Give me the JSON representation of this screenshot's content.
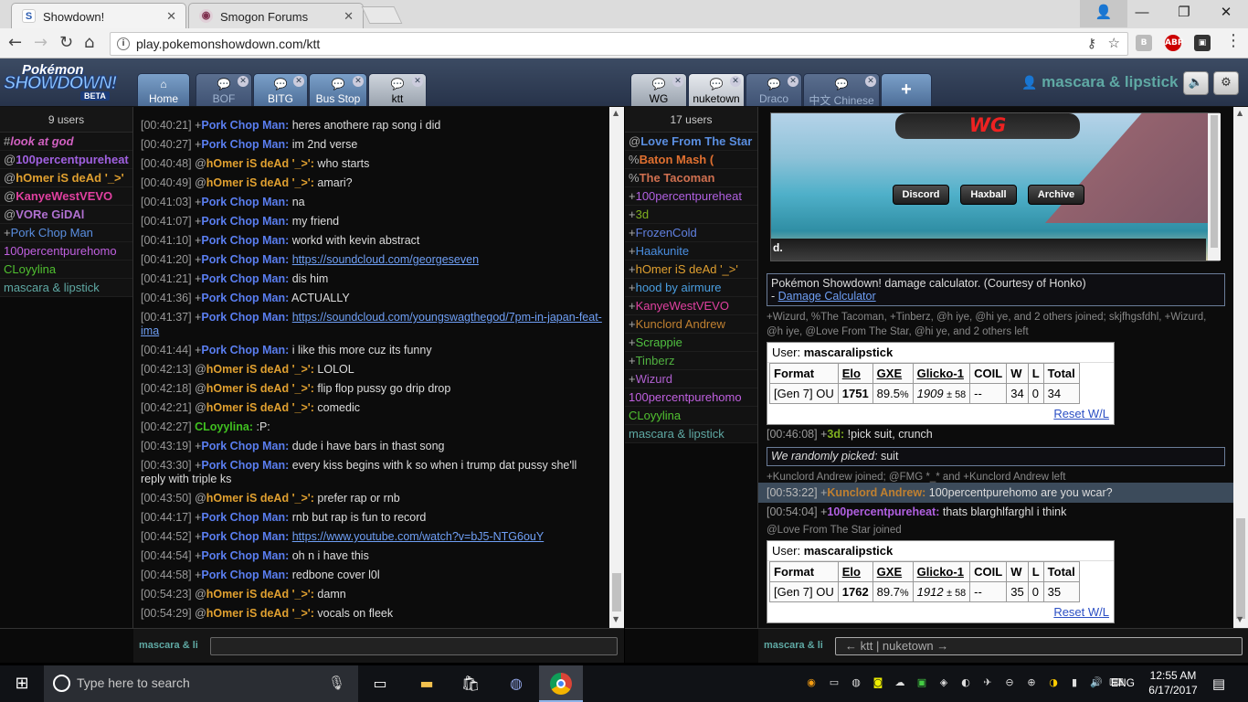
{
  "browser": {
    "tabs": [
      {
        "title": "Showdown!",
        "active": true
      },
      {
        "title": "Smogon Forums",
        "active": false
      }
    ],
    "url": "play.pokemonshowdown.com/ktt"
  },
  "ps": {
    "logo_top": "Pokémon",
    "logo_main": "SHOWDOWN!",
    "logo_badge": "BETA",
    "left_tabs": [
      "Home",
      "BOF",
      "BITG",
      "Bus Stop",
      "ktt"
    ],
    "right_tabs": [
      "WG",
      "nuketown",
      "Draco",
      "中文 Chinese"
    ],
    "add_tab": "+",
    "username": "mascara & lipstick"
  },
  "room1": {
    "user_count": "9 users",
    "users": [
      {
        "rank": "#",
        "name": "look at god",
        "color": "#d060c0"
      },
      {
        "rank": "@",
        "name": "100percentpureheat",
        "color": "#a060e0"
      },
      {
        "rank": "@",
        "name": "hOmer iS deAd '_>'",
        "color": "#e0a030"
      },
      {
        "rank": "@",
        "name": "KanyeWestVEVO",
        "color": "#e040a0"
      },
      {
        "rank": "@",
        "name": "VORe GiDAl",
        "color": "#b070d0"
      },
      {
        "rank": "+",
        "name": "Pork Chop Man",
        "color": "#5a8ee0"
      },
      {
        "rank": " ",
        "name": "100percentpurehomo",
        "color": "#c060e0"
      },
      {
        "rank": " ",
        "name": "CLoyylina",
        "color": "#50c030"
      },
      {
        "rank": " ",
        "name": "mascara & lipstick",
        "color": "#5fa9a4"
      }
    ],
    "messages": [
      {
        "t": "[00:40:21]",
        "rank": "+",
        "user": "Pork Chop Man:",
        "c": "#5a7ef0",
        "msg": "heres anothere rap song i did"
      },
      {
        "t": "[00:40:27]",
        "rank": "+",
        "user": "Pork Chop Man:",
        "c": "#5a7ef0",
        "msg": "im 2nd verse"
      },
      {
        "t": "[00:40:48]",
        "rank": "@",
        "user": "hOmer iS deAd '_>':",
        "c": "#e0a030",
        "msg": "who starts"
      },
      {
        "t": "[00:40:49]",
        "rank": "@",
        "user": "hOmer iS deAd '_>':",
        "c": "#e0a030",
        "msg": "amari?"
      },
      {
        "t": "[00:41:03]",
        "rank": "+",
        "user": "Pork Chop Man:",
        "c": "#5a7ef0",
        "msg": "na"
      },
      {
        "t": "[00:41:07]",
        "rank": "+",
        "user": "Pork Chop Man:",
        "c": "#5a7ef0",
        "msg": "my friend"
      },
      {
        "t": "[00:41:10]",
        "rank": "+",
        "user": "Pork Chop Man:",
        "c": "#5a7ef0",
        "msg": "workd with kevin abstract"
      },
      {
        "t": "[00:41:20]",
        "rank": "+",
        "user": "Pork Chop Man:",
        "c": "#5a7ef0",
        "msg": "https://soundcloud.com/georgeseven",
        "link": true
      },
      {
        "t": "[00:41:21]",
        "rank": "+",
        "user": "Pork Chop Man:",
        "c": "#5a7ef0",
        "msg": "dis him"
      },
      {
        "t": "[00:41:36]",
        "rank": "+",
        "user": "Pork Chop Man:",
        "c": "#5a7ef0",
        "msg": "ACTUALLY"
      },
      {
        "t": "[00:41:37]",
        "rank": "+",
        "user": "Pork Chop Man:",
        "c": "#5a7ef0",
        "msg": "https://soundcloud.com/youngswagthegod/7pm-in-japan-feat-ima",
        "link": true,
        "wrap": true
      },
      {
        "t": "[00:41:44]",
        "rank": "+",
        "user": "Pork Chop Man:",
        "c": "#5a7ef0",
        "msg": "i like this more cuz its funny"
      },
      {
        "t": "[00:42:13]",
        "rank": "@",
        "user": "hOmer iS deAd '_>':",
        "c": "#e0a030",
        "msg": "LOLOL"
      },
      {
        "t": "[00:42:18]",
        "rank": "@",
        "user": "hOmer iS deAd '_>':",
        "c": "#e0a030",
        "msg": "flip flop pussy go drip drop"
      },
      {
        "t": "[00:42:21]",
        "rank": "@",
        "user": "hOmer iS deAd '_>':",
        "c": "#e0a030",
        "msg": "comedic"
      },
      {
        "t": "[00:42:27]",
        "rank": "",
        "user": "CLoyylina:",
        "c": "#40c020",
        "msg": ":P:"
      },
      {
        "t": "[00:43:19]",
        "rank": "+",
        "user": "Pork Chop Man:",
        "c": "#5a7ef0",
        "msg": "dude i have bars in thast song"
      },
      {
        "t": "[00:43:30]",
        "rank": "+",
        "user": "Pork Chop Man:",
        "c": "#5a7ef0",
        "msg": "every kiss begins with k so when i trump dat pussy she'll reply with triple ks",
        "wrap": true
      },
      {
        "t": "[00:43:50]",
        "rank": "@",
        "user": "hOmer iS deAd '_>':",
        "c": "#e0a030",
        "msg": "prefer rap or rnb"
      },
      {
        "t": "[00:44:17]",
        "rank": "+",
        "user": "Pork Chop Man:",
        "c": "#5a7ef0",
        "msg": "rnb but rap is fun to record"
      },
      {
        "t": "[00:44:52]",
        "rank": "+",
        "user": "Pork Chop Man:",
        "c": "#5a7ef0",
        "msg": "https://www.youtube.com/watch?v=bJ5-NTG6ouY",
        "link": true
      },
      {
        "t": "[00:44:54]",
        "rank": "+",
        "user": "Pork Chop Man:",
        "c": "#5a7ef0",
        "msg": "oh n i have this"
      },
      {
        "t": "[00:44:58]",
        "rank": "+",
        "user": "Pork Chop Man:",
        "c": "#5a7ef0",
        "msg": "redbone cover l0l"
      },
      {
        "t": "[00:54:23]",
        "rank": "@",
        "user": "hOmer iS deAd '_>':",
        "c": "#e0a030",
        "msg": "damn"
      },
      {
        "t": "[00:54:29]",
        "rank": "@",
        "user": "hOmer iS deAd '_>':",
        "c": "#e0a030",
        "msg": "vocals on fleek"
      }
    ],
    "input_user": "mascara & li"
  },
  "room2": {
    "user_count": "17 users",
    "users": [
      {
        "rank": "@",
        "name": "Love From The Star",
        "color": "#5a8ee0",
        "bold": true
      },
      {
        "rank": "%",
        "name": "Baton Mash (",
        "color": "#e07030",
        "bold": true
      },
      {
        "rank": "%",
        "name": "The Tacoman",
        "color": "#d07050",
        "bold": true
      },
      {
        "rank": "+",
        "name": "100percentpureheat",
        "color": "#b060e0"
      },
      {
        "rank": "+",
        "name": "3d",
        "color": "#80b020"
      },
      {
        "rank": "+",
        "name": "FrozenCold",
        "color": "#6080e0"
      },
      {
        "rank": "+",
        "name": "Haakunite",
        "color": "#4a8ee0"
      },
      {
        "rank": "+",
        "name": "hOmer iS deAd '_>'",
        "color": "#e0a030"
      },
      {
        "rank": "+",
        "name": "hood by airmure",
        "color": "#4a9ee0"
      },
      {
        "rank": "+",
        "name": "KanyeWestVEVO",
        "color": "#e040a0"
      },
      {
        "rank": "+",
        "name": "Kunclord Andrew",
        "color": "#c08030"
      },
      {
        "rank": "+",
        "name": "Scrappie",
        "color": "#50c040"
      },
      {
        "rank": "+",
        "name": "Tinberz",
        "color": "#50b040"
      },
      {
        "rank": "+",
        "name": "Wizurd",
        "color": "#b060d0"
      },
      {
        "rank": " ",
        "name": "100percentpurehomo",
        "color": "#c060e0"
      },
      {
        "rank": " ",
        "name": "CLoyylina",
        "color": "#50c030"
      },
      {
        "rank": " ",
        "name": "mascara & lipstick",
        "color": "#5fa9a4"
      }
    ],
    "banner": {
      "title": "WG",
      "buttons": [
        "Discord",
        "Haxball",
        "Archive"
      ],
      "strip": "d."
    },
    "calc": {
      "text": "Pokémon Showdown! damage calculator. (Courtesy of Honko)",
      "dash": "- ",
      "link": "Damage Calculator"
    },
    "join1": "+Wizurd, %The Tacoman, +Tinberz, @h iye, @hi ye, and 2 others joined; skjfhgsfdhl, +Wizurd, @h iye, @Love From The Star, @hi ye, and 2 others left",
    "ladder1": {
      "label": "User:",
      "user": "mascaralipstick",
      "headers": [
        "Format",
        "Elo",
        "GXE",
        "Glicko-1",
        "COIL",
        "W",
        "L",
        "Total"
      ],
      "row": {
        "format": "[Gen 7] OU",
        "elo": "1751",
        "gxe": "89.5",
        "gxe_unit": "%",
        "glicko": "1909",
        "glicko_dev": "± 58",
        "coil": "--",
        "w": "34",
        "l": "0",
        "total": "34"
      },
      "reset": "Reset W/L"
    },
    "pick": {
      "t": "[00:46:08]",
      "rank": "+",
      "user": "3d:",
      "msg": "!pick suit, crunch"
    },
    "random": {
      "prefix": "We randomly picked:",
      "value": "suit"
    },
    "join2": "+Kunclord Andrew joined; @FMG *_* and +Kunclord Andrew left",
    "hl": {
      "t": "[00:53:22]",
      "rank": "+",
      "user": "Kunclord Andrew:",
      "msg": "100percentpurehomo are you wcar?"
    },
    "msg2": {
      "t": "[00:54:04]",
      "rank": "+",
      "user": "100percentpureheat:",
      "msg": "thats blarghlfarghl i think"
    },
    "join3": "@Love From The Star joined",
    "ladder2": {
      "label": "User:",
      "user": "mascaralipstick",
      "headers": [
        "Format",
        "Elo",
        "GXE",
        "Glicko-1",
        "COIL",
        "W",
        "L",
        "Total"
      ],
      "row": {
        "format": "[Gen 7] OU",
        "elo": "1762",
        "gxe": "89.7",
        "gxe_unit": "%",
        "glicko": "1912",
        "glicko_dev": "± 58",
        "coil": "--",
        "w": "35",
        "l": "0",
        "total": "35"
      },
      "reset": "Reset W/L"
    },
    "input_user": "mascara & li",
    "input_placeholder": "← ktt | nuketown →"
  },
  "taskbar": {
    "search_placeholder": "Type here to search",
    "lang": "ENG",
    "time": "12:55 AM",
    "date": "6/17/2017"
  }
}
